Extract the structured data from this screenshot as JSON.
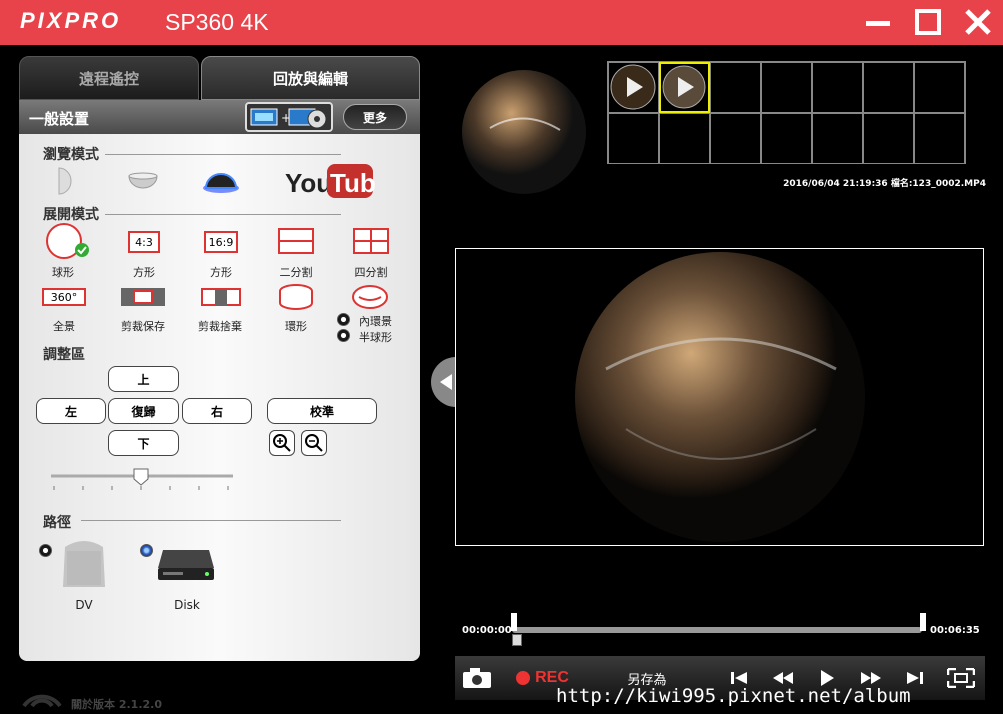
{
  "titlebar": {
    "brand": "PIXPRO",
    "model": "SP360 4K",
    "minimize_icon": "minimize-icon",
    "maximize_icon": "maximize-icon",
    "close_icon": "close-icon"
  },
  "tabs": [
    {
      "label": "遠程遙控",
      "active": false
    },
    {
      "label": "回放與編輯",
      "active": true
    }
  ],
  "panel": {
    "header_title": "一般設置",
    "more_label": "更多",
    "browse_mode_title": "瀏覽模式",
    "youtube_label": "YouTube",
    "expand_mode_title": "展開模式",
    "expand_items": [
      {
        "label": "球形"
      },
      {
        "label": "方形",
        "icon_text": "4:3"
      },
      {
        "label": "方形",
        "icon_text": "16:9"
      },
      {
        "label": "二分割"
      },
      {
        "label": "四分割"
      },
      {
        "label": "全景",
        "icon_text": "360°"
      },
      {
        "label": "剪裁保存"
      },
      {
        "label": "剪裁捨棄"
      },
      {
        "label": "環形"
      }
    ],
    "ring_options": [
      "內環景",
      "半球形"
    ],
    "adjust_title": "調整區",
    "adjust": {
      "up": "上",
      "left": "左",
      "reset": "復歸",
      "right": "右",
      "down": "下",
      "calibrate": "校準"
    },
    "slider_value": 0.5,
    "path_title": "路徑",
    "path_options": [
      {
        "label": "DV",
        "selected": false
      },
      {
        "label": "Disk",
        "selected": true
      }
    ]
  },
  "file_info": "2016/06/04 21:19:36 檔名:123_0002.MP4",
  "timeline": {
    "start": "00:00:00",
    "end": "00:06:35"
  },
  "controls": {
    "rec_label": "REC",
    "save_as_label": "另存為"
  },
  "footer": {
    "version_label": "關於版本 2.1.2.0"
  },
  "watermark": "http://kiwi995.pixnet.net/album"
}
